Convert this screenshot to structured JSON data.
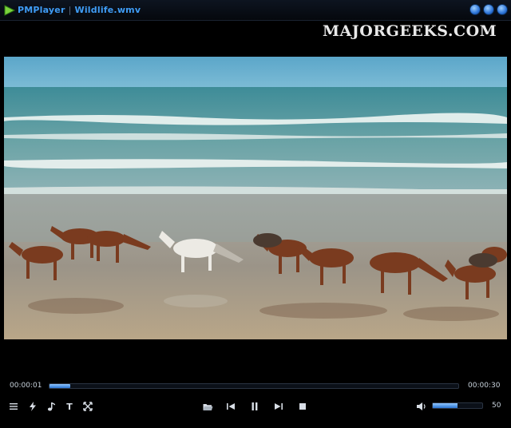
{
  "window": {
    "app_name": "PMPlayer",
    "separator": "|",
    "file_name": "Wildlife.wmv"
  },
  "watermark": "MAJORGEEKS.COM",
  "playback": {
    "current_time": "00:00:01",
    "total_time": "00:00:30",
    "progress_fraction": 0.05,
    "volume": "50",
    "volume_fraction": 0.5
  },
  "controls": {
    "left": [
      "playlist-icon",
      "effects-icon",
      "audio-icon",
      "subtitle-icon",
      "fullscreen-icon"
    ],
    "center": [
      "open-folder-icon",
      "previous-icon",
      "pause-icon",
      "next-icon",
      "stop-icon"
    ],
    "right": [
      "speaker-icon"
    ],
    "subtitle_glyph": "T"
  },
  "colors": {
    "title": "#3f9cf5",
    "accent": "#2a74d1",
    "background": "#000000"
  }
}
